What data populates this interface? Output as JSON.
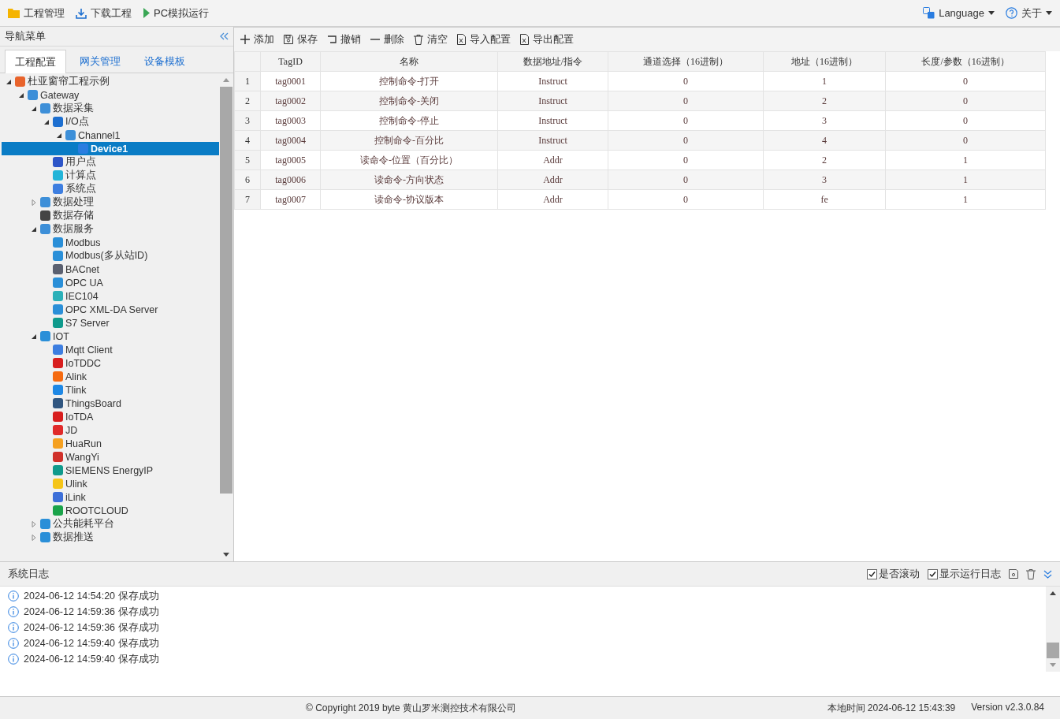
{
  "menubar": {
    "items": [
      {
        "label": "工程管理",
        "kind": "folder"
      },
      {
        "label": "下载工程",
        "kind": "download"
      },
      {
        "label": "PC模拟运行",
        "kind": "play"
      }
    ],
    "right": [
      {
        "label": "Language",
        "kind": "language"
      },
      {
        "label": "关于",
        "kind": "help"
      }
    ]
  },
  "nav": {
    "title": "导航菜单",
    "tabs": [
      {
        "label": "工程配置",
        "selected": true
      },
      {
        "label": "网关管理",
        "selected": false
      },
      {
        "label": "设备模板",
        "selected": false
      }
    ],
    "tree": [
      {
        "label": "杜亚窗帘工程示例",
        "color": "#e8632b",
        "expanded": true,
        "selected": false,
        "children": [
          {
            "label": "Gateway",
            "color": "#3d8fd8",
            "expanded": true,
            "selected": false,
            "children": [
              {
                "label": "数据采集",
                "color": "#3d8fd8",
                "expanded": true,
                "selected": false,
                "children": [
                  {
                    "label": "I/O点",
                    "color": "#1d6fd0",
                    "expanded": true,
                    "selected": false,
                    "children": [
                      {
                        "label": "Channel1",
                        "color": "#3d8fd8",
                        "expanded": true,
                        "selected": false,
                        "children": [
                          {
                            "label": "Device1",
                            "color": "#2a7de0",
                            "selected": true
                          }
                        ]
                      }
                    ]
                  },
                  {
                    "label": "用户点",
                    "color": "#2d55c8",
                    "selected": false
                  },
                  {
                    "label": "计算点",
                    "color": "#22b4d8",
                    "selected": false
                  },
                  {
                    "label": "系统点",
                    "color": "#3d7ee0",
                    "selected": false
                  }
                ]
              },
              {
                "label": "数据处理",
                "color": "#3d8fd8",
                "expanded": false,
                "selected": false
              },
              {
                "label": "数据存储",
                "color": "#444444",
                "selected": false
              },
              {
                "label": "数据服务",
                "color": "#3d8fd8",
                "expanded": true,
                "selected": false,
                "children": [
                  {
                    "label": "Modbus",
                    "color": "#2a8fd8",
                    "selected": false
                  },
                  {
                    "label": "Modbus(多从站ID)",
                    "color": "#2a8fd8",
                    "selected": false
                  },
                  {
                    "label": "BACnet",
                    "color": "#5a6070",
                    "selected": false
                  },
                  {
                    "label": "OPC UA",
                    "color": "#2a8fd8",
                    "selected": false
                  },
                  {
                    "label": "IEC104",
                    "color": "#2bb0b8",
                    "selected": false
                  },
                  {
                    "label": "OPC XML-DA Server",
                    "color": "#2a8fd8",
                    "selected": false
                  },
                  {
                    "label": "S7 Server",
                    "color": "#0f9a8c",
                    "selected": false
                  }
                ]
              },
              {
                "label": "IOT",
                "color": "#2a8fd8",
                "expanded": true,
                "selected": false,
                "children": [
                  {
                    "label": "Mqtt Client",
                    "color": "#3d7ee0",
                    "selected": false
                  },
                  {
                    "label": "IoTDDC",
                    "color": "#d81e1e",
                    "selected": false
                  },
                  {
                    "label": "Alink",
                    "color": "#f56a10",
                    "selected": false
                  },
                  {
                    "label": "Tlink",
                    "color": "#1e88e5",
                    "selected": false
                  },
                  {
                    "label": "ThingsBoard",
                    "color": "#305680",
                    "selected": false
                  },
                  {
                    "label": "IoTDA",
                    "color": "#d81e1e",
                    "selected": false
                  },
                  {
                    "label": "JD",
                    "color": "#e02a2a",
                    "selected": false
                  },
                  {
                    "label": "HuaRun",
                    "color": "#f5a020",
                    "selected": false
                  },
                  {
                    "label": "WangYi",
                    "color": "#d0302a",
                    "selected": false
                  },
                  {
                    "label": "SIEMENS EnergyIP",
                    "color": "#0f9a8c",
                    "selected": false
                  },
                  {
                    "label": "Ulink",
                    "color": "#f5c518",
                    "selected": false
                  },
                  {
                    "label": "iLink",
                    "color": "#3d6fd8",
                    "selected": false
                  },
                  {
                    "label": "ROOTCLOUD",
                    "color": "#1aa34a",
                    "selected": false
                  }
                ]
              },
              {
                "label": "公共能耗平台",
                "color": "#2a8fd8",
                "expanded": false,
                "selected": false
              },
              {
                "label": "数据推送",
                "color": "#2a8fd8",
                "expanded": false,
                "selected": false
              }
            ]
          }
        ]
      }
    ]
  },
  "toolbar": [
    {
      "label": "添加",
      "kind": "add"
    },
    {
      "label": "保存",
      "kind": "save"
    },
    {
      "label": "撤销",
      "kind": "undo"
    },
    {
      "label": "删除",
      "kind": "remove"
    },
    {
      "label": "清空",
      "kind": "clear"
    },
    {
      "label": "导入配置",
      "kind": "excel"
    },
    {
      "label": "导出配置",
      "kind": "excel"
    }
  ],
  "table": {
    "columns": [
      "TagID",
      "名称",
      "数据地址/指令",
      "通道选择（16进制）",
      "地址（16进制）",
      "长度/参数（16进制）"
    ],
    "rows": [
      {
        "index": "1",
        "cells": [
          "tag0001",
          "控制命令-打开",
          "Instruct",
          "0",
          "1",
          "0"
        ]
      },
      {
        "index": "2",
        "cells": [
          "tag0002",
          "控制命令-关闭",
          "Instruct",
          "0",
          "2",
          "0"
        ]
      },
      {
        "index": "3",
        "cells": [
          "tag0003",
          "控制命令-停止",
          "Instruct",
          "0",
          "3",
          "0"
        ]
      },
      {
        "index": "4",
        "cells": [
          "tag0004",
          "控制命令-百分比",
          "Instruct",
          "0",
          "4",
          "0"
        ]
      },
      {
        "index": "5",
        "cells": [
          "tag0005",
          "读命令-位置（百分比）",
          "Addr",
          "0",
          "2",
          "1"
        ]
      },
      {
        "index": "6",
        "cells": [
          "tag0006",
          "读命令-方向状态",
          "Addr",
          "0",
          "3",
          "1"
        ]
      },
      {
        "index": "7",
        "cells": [
          "tag0007",
          "读命令-协议版本",
          "Addr",
          "0",
          "fe",
          "1"
        ]
      }
    ]
  },
  "log": {
    "title": "系统日志",
    "options": [
      {
        "label": "是否滚动",
        "checked": true
      },
      {
        "label": "显示运行日志",
        "checked": true
      }
    ],
    "entries": [
      "2024-06-12 14:54:20 保存成功",
      "2024-06-12 14:59:36 保存成功",
      "2024-06-12 14:59:36 保存成功",
      "2024-06-12 14:59:40 保存成功",
      "2024-06-12 14:59:40 保存成功"
    ]
  },
  "status_bar": {
    "copyright": "© Copyright 2019 byte 黄山罗米测控技术有限公司",
    "local_time": "本地时间 2024-06-12 15:43:39",
    "version": "Version v2.3.0.84"
  }
}
